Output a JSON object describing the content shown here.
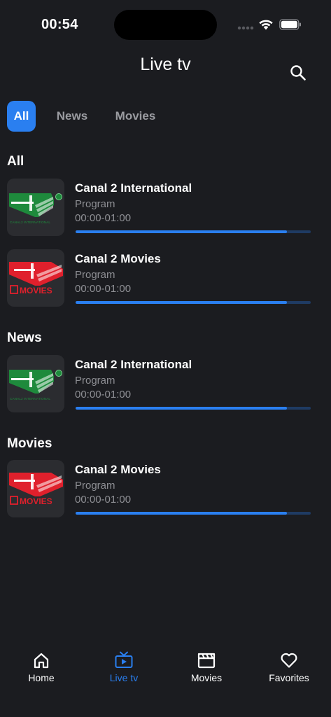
{
  "status_bar": {
    "time": "00:54"
  },
  "header": {
    "title": "Live tv",
    "search_icon": "search-icon"
  },
  "filters": {
    "tabs": [
      {
        "label": "All",
        "active": true
      },
      {
        "label": "News",
        "active": false
      },
      {
        "label": "Movies",
        "active": false
      }
    ]
  },
  "sections": [
    {
      "title": "All",
      "channels": [
        {
          "name": "Canal 2 International",
          "program": "Program",
          "time": "00:00-01:00",
          "logo": "canal2-international-logo",
          "progress": 0.9
        },
        {
          "name": "Canal 2 Movies",
          "program": "Program",
          "time": "00:00-01:00",
          "logo": "canal2-movies-logo",
          "progress": 0.9
        }
      ]
    },
    {
      "title": "News",
      "channels": [
        {
          "name": "Canal 2 International",
          "program": "Program",
          "time": "00:00-01:00",
          "logo": "canal2-international-logo",
          "progress": 0.9
        }
      ]
    },
    {
      "title": "Movies",
      "channels": [
        {
          "name": "Canal 2 Movies",
          "program": "Program",
          "time": "00:00-01:00",
          "logo": "canal2-movies-logo",
          "progress": 0.9
        }
      ]
    }
  ],
  "logo_text": {
    "international": "CANAL2 INTERNATIONAL",
    "movies": "MOVIES"
  },
  "tab_bar": {
    "items": [
      {
        "label": "Home",
        "icon": "home-icon",
        "active": false
      },
      {
        "label": "Live tv",
        "icon": "tv-icon",
        "active": true
      },
      {
        "label": "Movies",
        "icon": "clapperboard-icon",
        "active": false
      },
      {
        "label": "Favorites",
        "icon": "heart-icon",
        "active": false
      }
    ]
  },
  "colors": {
    "background": "#1b1c20",
    "accent": "#2a7ff0",
    "muted_text": "#8e8f94",
    "thumb_background": "#2b2c30",
    "canal2_green": "#1e8a3c",
    "canal2_red": "#e0202c"
  }
}
